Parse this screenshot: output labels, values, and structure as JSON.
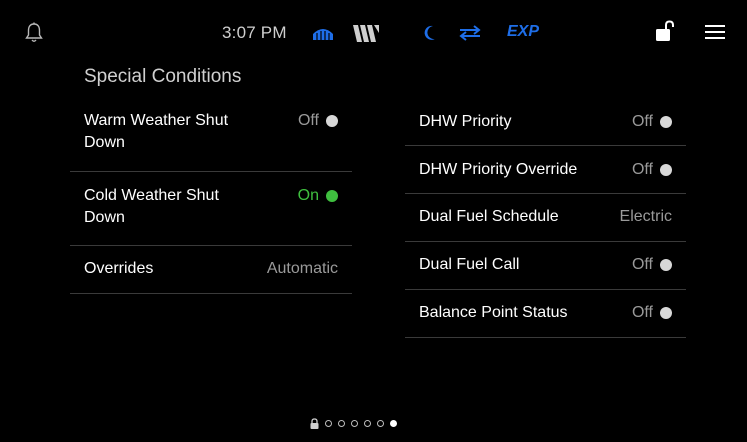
{
  "header": {
    "time": "3:07 PM",
    "mode_label": "EXP",
    "icons": {
      "bell": "bell-icon",
      "heat": "heat-dome-icon",
      "boiler": "boiler-w-icon",
      "night": "moon-icon",
      "exchange": "exchange-arrows-icon",
      "lock": "unlock-icon",
      "menu": "hamburger-menu-icon"
    },
    "colors": {
      "accent_blue": "#1e6ee8",
      "icon_gray": "#b8b8b8"
    }
  },
  "page": {
    "title": "Special Conditions"
  },
  "left_rows": [
    {
      "label": "Warm Weather Shut Down",
      "value": "Off",
      "indicator": "#d8d8d8",
      "value_color": "#9a9a9a"
    },
    {
      "label": "Cold Weather Shut Down",
      "value": "On",
      "indicator": "#3fbf3f",
      "value_color": "#3fbf3f"
    },
    {
      "label": "Overrides",
      "value": "Automatic",
      "indicator": null,
      "value_color": "#9a9a9a"
    }
  ],
  "right_rows": [
    {
      "label": "DHW Priority",
      "value": "Off",
      "indicator": "#d8d8d8",
      "value_color": "#9a9a9a"
    },
    {
      "label": "DHW Priority Override",
      "value": "Off",
      "indicator": "#d8d8d8",
      "value_color": "#9a9a9a"
    },
    {
      "label": "Dual Fuel Schedule",
      "value": "Electric",
      "indicator": null,
      "value_color": "#9a9a9a"
    },
    {
      "label": "Dual Fuel Call",
      "value": "Off",
      "indicator": "#d8d8d8",
      "value_color": "#9a9a9a"
    },
    {
      "label": "Balance Point Status",
      "value": "Off",
      "indicator": "#d8d8d8",
      "value_color": "#9a9a9a"
    }
  ],
  "pager": {
    "lock_icon": "padlock-icon",
    "page_count": 6,
    "active_index": 5
  }
}
